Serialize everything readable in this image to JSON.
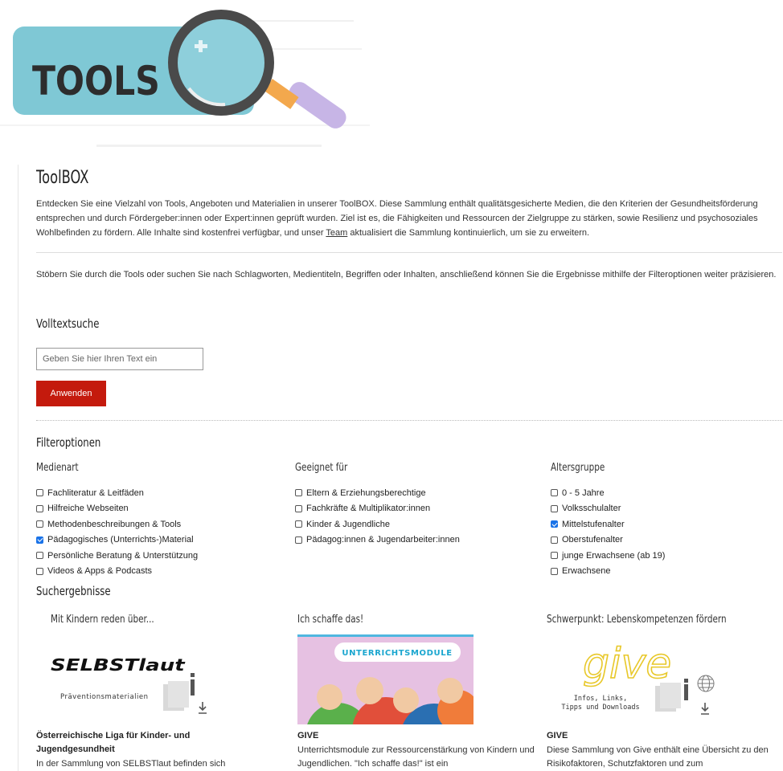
{
  "banner": {
    "word": "TOOLS"
  },
  "page": {
    "title": "ToolBOX",
    "intro_text": "Entdecken Sie eine Vielzahl von Tools, Angeboten und Materialien in unserer ToolBOX. Diese Sammlung enthält qualitätsgesicherte Medien, die den Kriterien der Gesundheitsförderung entsprechen und durch Fördergeber:innen oder Expert:innen geprüft wurden. Ziel ist es, die Fähigkeiten und Ressourcen der Zielgruppe zu stärken, sowie Resilienz und psychosoziales Wohlbefinden zu fördern. Alle Inhalte sind kostenfrei verfügbar, und unser ",
    "intro_link": "Team",
    "intro_tail": " aktualisiert die Sammlung kontinuierlich, um sie zu erweitern.",
    "hint_text": "Stöbern Sie durch die Tools oder suchen Sie nach Schlagworten, Medientiteln, Begriffen oder Inhalten, anschließend können Sie die Ergebnisse mithilfe der Filteroptionen weiter präzisieren."
  },
  "search": {
    "heading": "Volltextsuche",
    "placeholder": "Geben Sie hier Ihren Text ein",
    "value": "",
    "button_label": "Anwenden"
  },
  "filters": {
    "heading": "Filteroptionen",
    "groups": [
      {
        "title": "Medienart",
        "options": [
          {
            "label": "Fachliteratur & Leitfäden",
            "checked": false
          },
          {
            "label": "Hilfreiche Webseiten",
            "checked": false
          },
          {
            "label": "Methodenbeschreibungen & Tools",
            "checked": false
          },
          {
            "label": "Pädagogisches (Unterrichts-)Material",
            "checked": true
          },
          {
            "label": "Persönliche Beratung & Unterstützung",
            "checked": false
          },
          {
            "label": "Videos & Apps & Podcasts",
            "checked": false
          }
        ]
      },
      {
        "title": "Geeignet für",
        "options": [
          {
            "label": "Eltern & Erziehungsberechtige",
            "checked": false
          },
          {
            "label": "Fachkräfte & Multiplikator:innen",
            "checked": false
          },
          {
            "label": "Kinder & Jugendliche",
            "checked": false
          },
          {
            "label": "Pädagog:innen & Jugendarbeiter:innen",
            "checked": false
          }
        ]
      },
      {
        "title": "Altersgruppe",
        "options": [
          {
            "label": "0 - 5 Jahre",
            "checked": false
          },
          {
            "label": "Volksschulalter",
            "checked": false
          },
          {
            "label": "Mittelstufenalter",
            "checked": true
          },
          {
            "label": "Oberstufenalter",
            "checked": false
          },
          {
            "label": "junge Erwachsene (ab 19)",
            "checked": false
          },
          {
            "label": "Erwachsene",
            "checked": false
          }
        ]
      }
    ]
  },
  "results": {
    "heading": "Suchergebnisse",
    "items": [
      {
        "title": "Mit Kindern reden über...",
        "logo_text": "SELBSTlaut",
        "logo_sub": "Präventionsmaterialien",
        "org": "Österreichische Liga für Kinder- und Jugendgesundheit",
        "desc": "In der Sammlung von SELBSTlaut befinden sich"
      },
      {
        "title": "Ich schaffe das!",
        "banner_text": "UNTERRICHTSMODULE",
        "org": "GIVE",
        "desc": "Unterrichtsmodule zur Ressourcenstärkung von Kindern und Jugendlichen. \"Ich schaffe das!\" ist ein"
      },
      {
        "title": "Schwerpunkt: Lebenskompetenzen fördern",
        "logo_text": "give",
        "logo_sub1": "Infos, Links,",
        "logo_sub2": "Tipps und Downloads",
        "org": "GIVE",
        "desc": "Diese Sammlung von Give enthält eine Übersicht zu den Risikofaktoren, Schutzfaktoren und zum"
      }
    ]
  }
}
